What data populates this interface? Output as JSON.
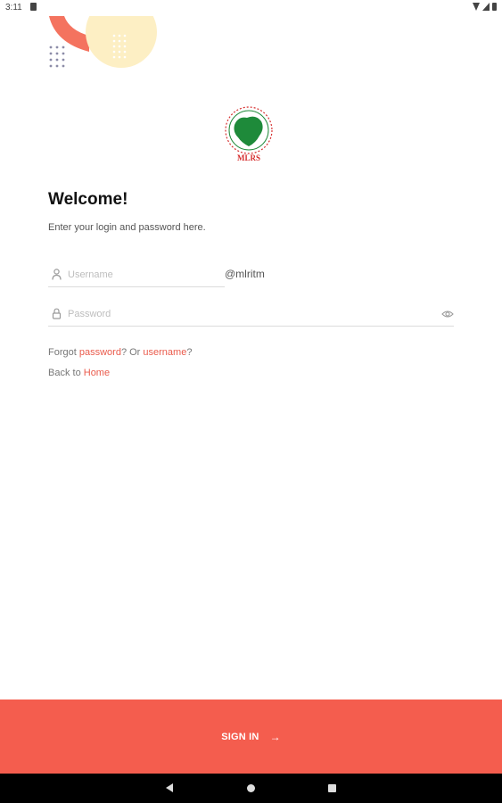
{
  "status_bar": {
    "time": "3:11"
  },
  "logo": {
    "text": "MLRS"
  },
  "welcome": {
    "title": "Welcome!",
    "subtitle": "Enter your login and password here."
  },
  "username": {
    "placeholder": "Username",
    "value": "",
    "suffix": "@mlritm",
    "icon": "person-icon"
  },
  "password": {
    "placeholder": "Password",
    "value": "",
    "icon": "lock-icon",
    "toggle_icon": "eye-icon"
  },
  "forgot": {
    "prefix": "Forgot ",
    "password_link": "password",
    "middle": "? Or ",
    "username_link": "username",
    "suffix": "?"
  },
  "back": {
    "prefix": "Back to ",
    "home_link": "Home"
  },
  "sign_in": {
    "label": "SIGN IN",
    "arrow": "→"
  },
  "colors": {
    "accent": "#f45d4e",
    "link": "#ea5b4c",
    "decor_yellow": "#fdefc4",
    "logo_green": "#1e8a3a",
    "logo_red": "#d62f2f"
  }
}
